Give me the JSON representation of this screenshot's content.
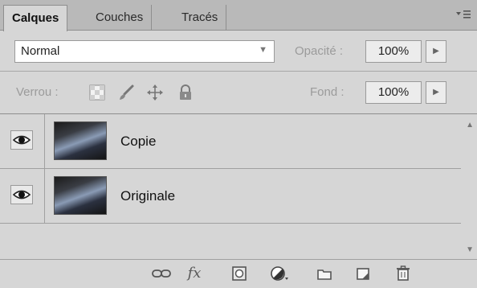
{
  "tabs": [
    "Calques",
    "Couches",
    "Tracés"
  ],
  "panel_menu_icon": "panel-menu-icon",
  "blend_mode": {
    "value": "Normal"
  },
  "opacity": {
    "label": "Opacité :",
    "value": "100%"
  },
  "lock": {
    "label": "Verrou :"
  },
  "fill": {
    "label": "Fond :",
    "value": "100%"
  },
  "layers": [
    {
      "name": "Copie",
      "visible": true
    },
    {
      "name": "Originale",
      "visible": true
    }
  ],
  "bottom_icons": [
    "link-layers-icon",
    "fx-icon",
    "mask-icon",
    "adjustment-icon",
    "group-folder-icon",
    "new-layer-icon",
    "trash-icon"
  ],
  "bottom_fx_label": "fx"
}
